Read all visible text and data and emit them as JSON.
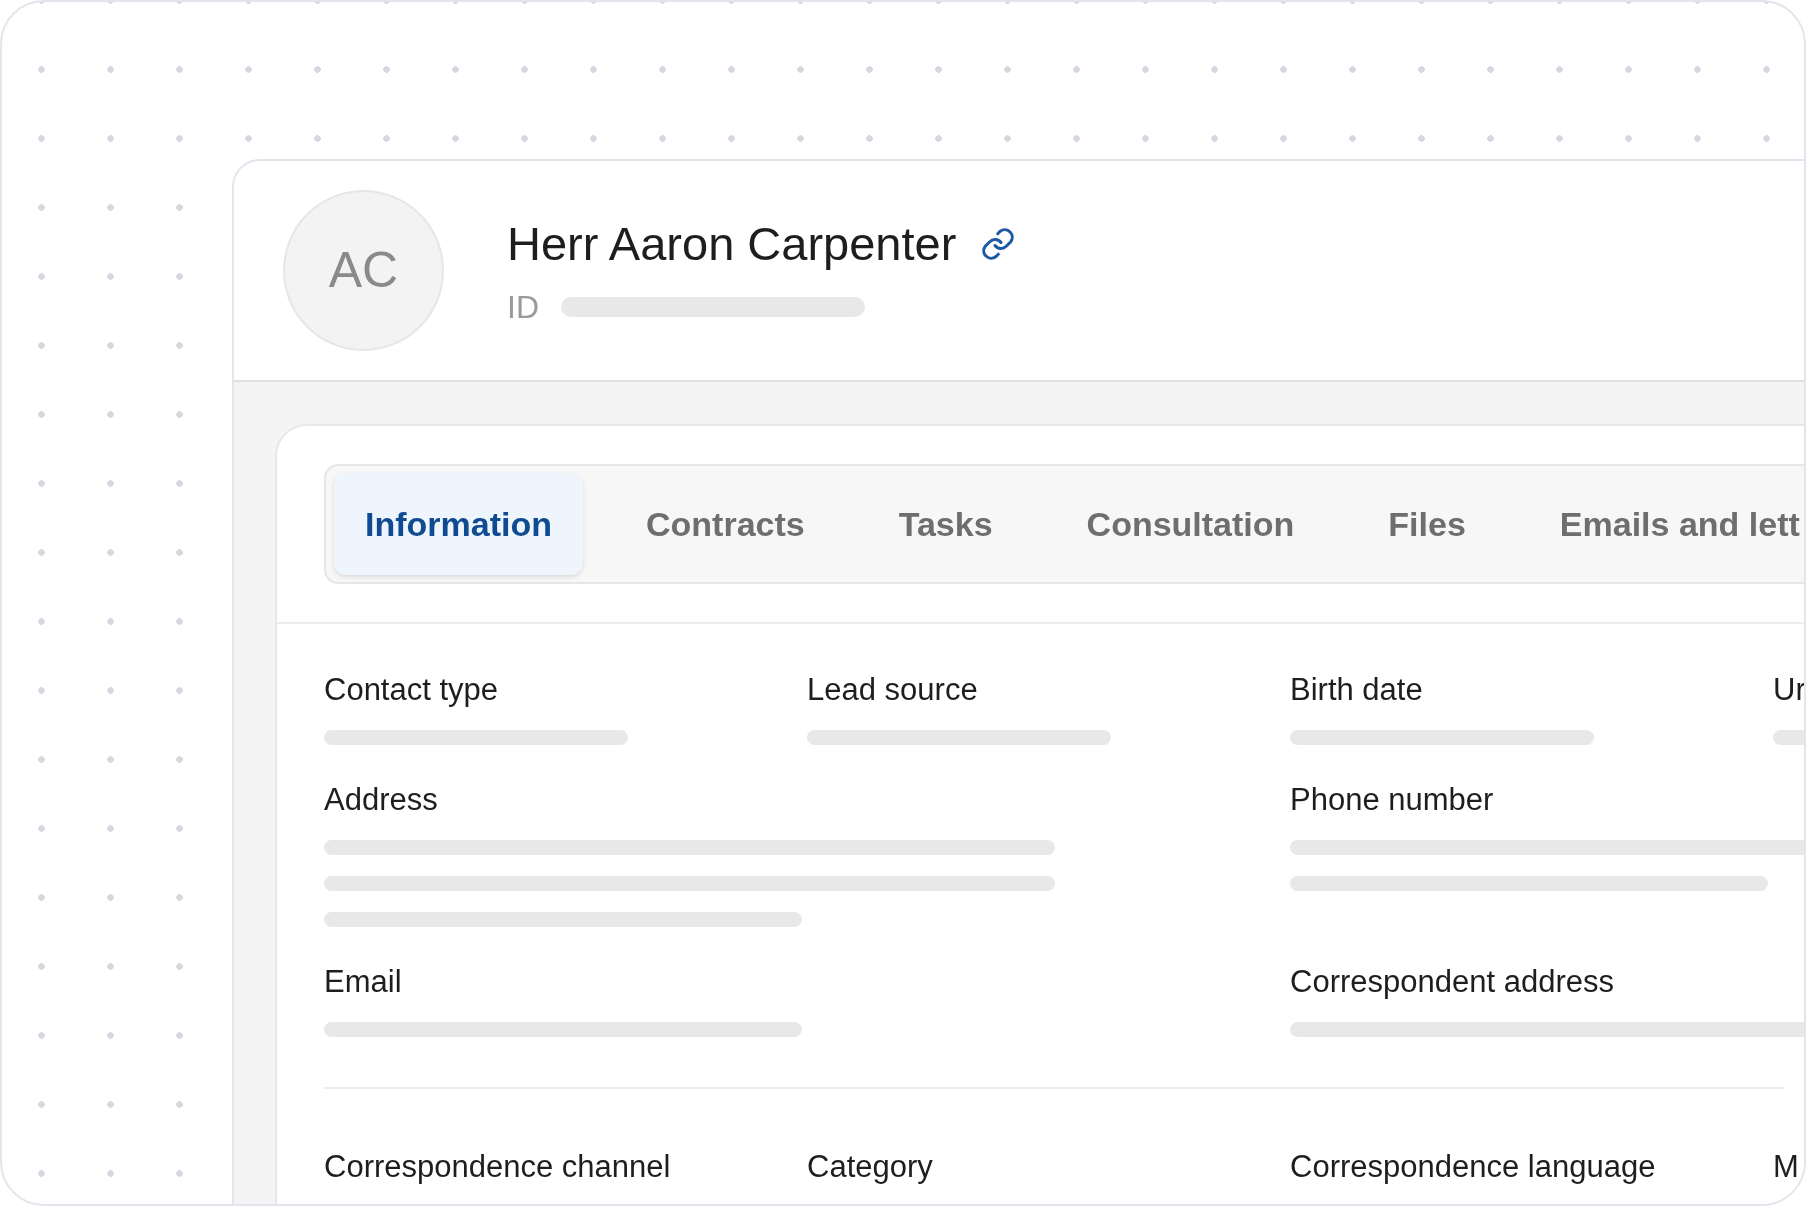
{
  "profile": {
    "avatar_initials": "AC",
    "name": "Herr Aaron Carpenter",
    "id_label": "ID"
  },
  "tabs": [
    {
      "label": "Information",
      "selected": true
    },
    {
      "label": "Contracts",
      "selected": false
    },
    {
      "label": "Tasks",
      "selected": false
    },
    {
      "label": "Consultation",
      "selected": false
    },
    {
      "label": "Files",
      "selected": false
    },
    {
      "label": "Emails and lett",
      "selected": false
    }
  ],
  "sections": [
    {
      "fields": [
        {
          "label": "Contact type",
          "kind": "short"
        },
        {
          "label": "Lead source",
          "kind": "short"
        },
        {
          "label": "Birth date",
          "kind": "short"
        },
        {
          "label": "Ur",
          "kind": "short"
        },
        {
          "label": "Address",
          "kind": "address"
        },
        {
          "label": "Phone number",
          "kind": "phone"
        },
        {
          "label": "Email",
          "kind": "email"
        },
        {
          "label": "Correspondent address",
          "kind": "wide"
        }
      ]
    },
    {
      "fields": [
        {
          "label": "Correspondence channel",
          "kind": "label"
        },
        {
          "label": "Category",
          "kind": "label"
        },
        {
          "label": "Correspondence language",
          "kind": "label"
        },
        {
          "label": "M",
          "kind": "label"
        }
      ]
    }
  ]
}
